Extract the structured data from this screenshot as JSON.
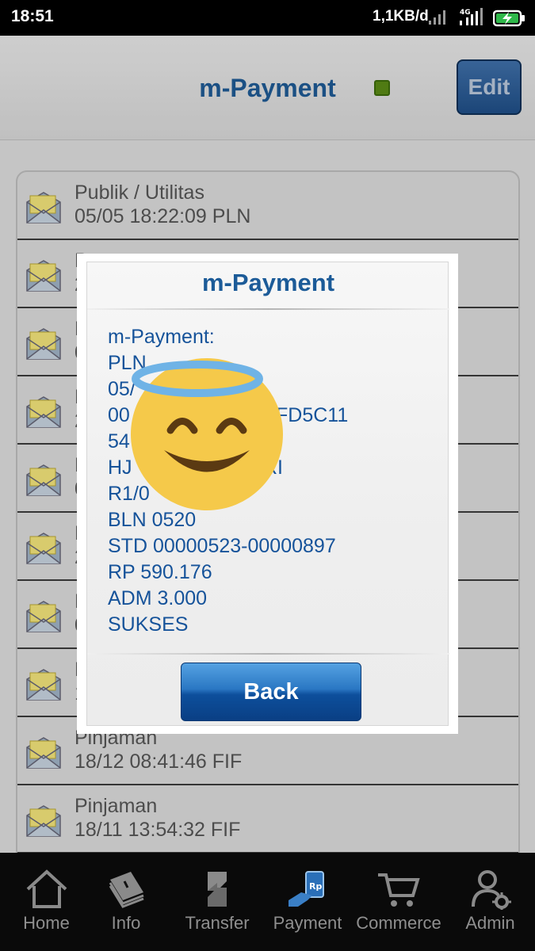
{
  "status_bar": {
    "time": "18:51",
    "net_speed": "1,1KB/d",
    "network_type": "4G",
    "icons": [
      "signal-icon",
      "signal-4g-icon",
      "battery-charging-icon"
    ]
  },
  "header": {
    "title": "m-Payment",
    "edit_label": "Edit",
    "status_color": "#5a8a16"
  },
  "messages": [
    {
      "title": "Publik / Utilitas",
      "detail": "05/05 18:22:09 PLN"
    },
    {
      "title": "P",
      "detail": "2"
    },
    {
      "title": "P",
      "detail": "0"
    },
    {
      "title": "P",
      "detail": "2"
    },
    {
      "title": "P",
      "detail": "0"
    },
    {
      "title": "P",
      "detail": "2"
    },
    {
      "title": "P",
      "detail": "0"
    },
    {
      "title": "P",
      "detail": "1"
    },
    {
      "title": "Pinjaman",
      "detail": "18/12 08:41:46 FIF"
    },
    {
      "title": "Pinjaman",
      "detail": "18/11 13:54:32 FIF"
    }
  ],
  "dialog": {
    "title": "m-Payment",
    "lines": [
      "m-Payment:",
      "PLN",
      "05/",
      "00",
      "54",
      "HJ",
      "R1/0",
      "BLN 0520",
      "STD 00000523-00000897",
      "RP 590.176",
      "ADM 3.000",
      "SUKSES"
    ],
    "partial_right": {
      "line4": "FD5C11",
      "line6": "RI"
    },
    "back_label": "Back"
  },
  "overlay_icon": "smiling-face-with-halo-emoji",
  "nav": [
    {
      "label": "Home",
      "icon": "home-icon"
    },
    {
      "label": "Info",
      "icon": "info-book-icon"
    },
    {
      "label": "Transfer",
      "icon": "transfer-icon"
    },
    {
      "label": "Payment",
      "icon": "payment-icon"
    },
    {
      "label": "Commerce",
      "icon": "cart-icon"
    },
    {
      "label": "Admin",
      "icon": "admin-icon"
    }
  ],
  "colors": {
    "brand_blue": "#1f5a93",
    "dialog_text": "#16539a",
    "nav_bg": "#0a0a0a"
  }
}
